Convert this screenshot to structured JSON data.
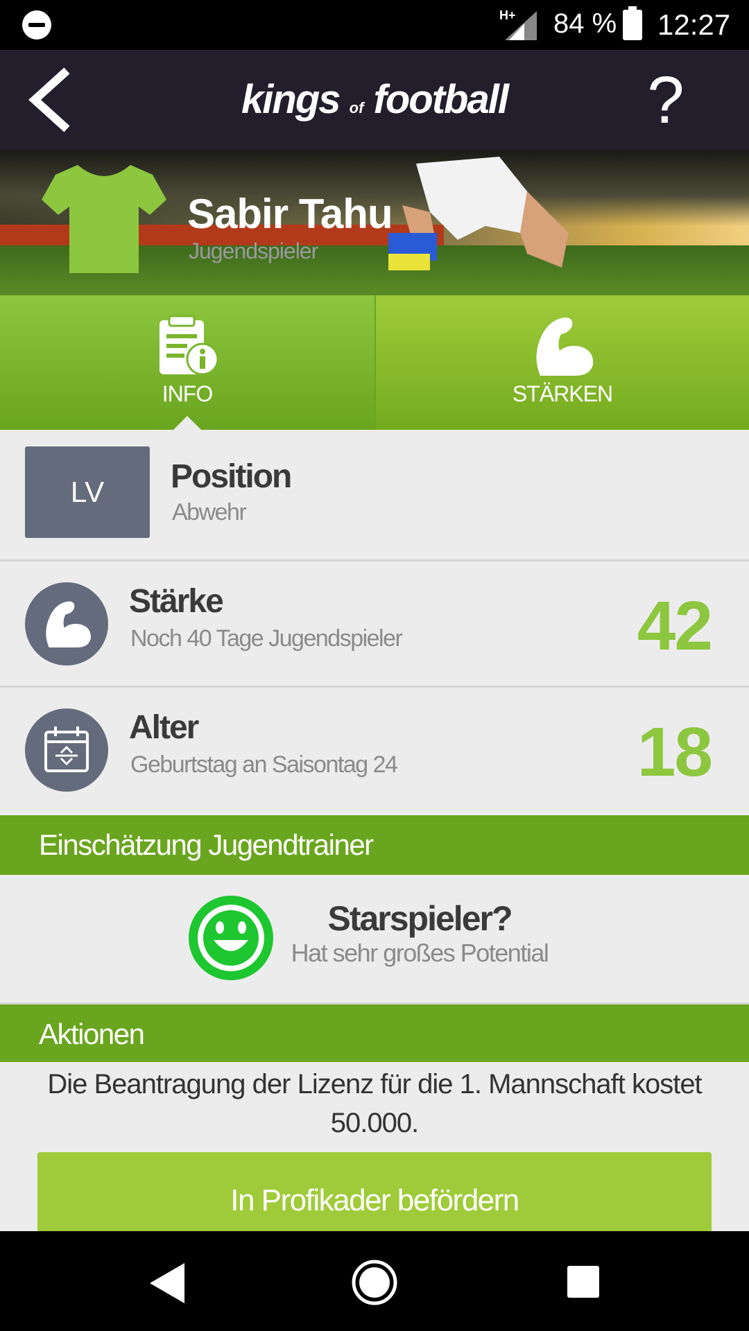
{
  "status_bar": {
    "network": "H+",
    "battery": "84 %",
    "time": "12:27",
    "icons": [
      "do-not-disturb-icon",
      "signal-icon",
      "battery-icon"
    ]
  },
  "app_bar": {
    "logo_left": "kings",
    "logo_of": "of",
    "logo_right": "football",
    "help": "?"
  },
  "hero": {
    "name": "Sabir Tahu",
    "subtitle": "Jugendspieler",
    "shirt_color": "#8dc63f"
  },
  "tabs": [
    {
      "label": "INFO",
      "active": true,
      "icon": "info-document-icon"
    },
    {
      "label": "STÄRKEN",
      "active": false,
      "icon": "flexed-arm-icon"
    }
  ],
  "position": {
    "badge": "LV",
    "title": "Position",
    "subtitle": "Abwehr"
  },
  "strength": {
    "title": "Stärke",
    "subtitle": "Noch 40 Tage Jugendspieler",
    "value": "42"
  },
  "age": {
    "title": "Alter",
    "subtitle": "Geburtstag an Saisontag 24",
    "value": "18"
  },
  "assessment": {
    "header": "Einschätzung Jugendtrainer",
    "title": "Starspieler?",
    "subtitle": "Hat sehr großes Potential"
  },
  "actions": {
    "header": "Aktionen",
    "license_text": "Die Beantragung der Lizenz für die 1. Mannschaft kostet 50.000.",
    "button": "In Profikader befördern"
  },
  "colors": {
    "accent_green": "#8dc63f",
    "section_green": "#6aa51f",
    "app_bar": "#231e2b",
    "badge_gray": "#646b7c",
    "smiley_green": "#1ec630"
  }
}
